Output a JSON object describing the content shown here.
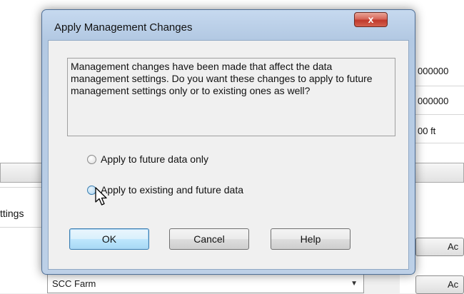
{
  "background": {
    "values": [
      "000000",
      "000000",
      "00 ft"
    ],
    "side_label": "ttings",
    "farm_select": {
      "value": "SCC Farm"
    },
    "right_buttons": [
      "Ac",
      "Ac"
    ]
  },
  "dialog": {
    "title": "Apply Management Changes",
    "close_label": "x",
    "message": "Management changes have been made that affect the data management settings. Do you want these changes to apply to future management settings only or to existing ones as well?",
    "options": [
      {
        "label": "Apply to future data only",
        "selected": false
      },
      {
        "label": "Apply to existing and future data",
        "selected": false
      }
    ],
    "buttons": {
      "ok": "OK",
      "cancel": "Cancel",
      "help": "Help"
    }
  }
}
